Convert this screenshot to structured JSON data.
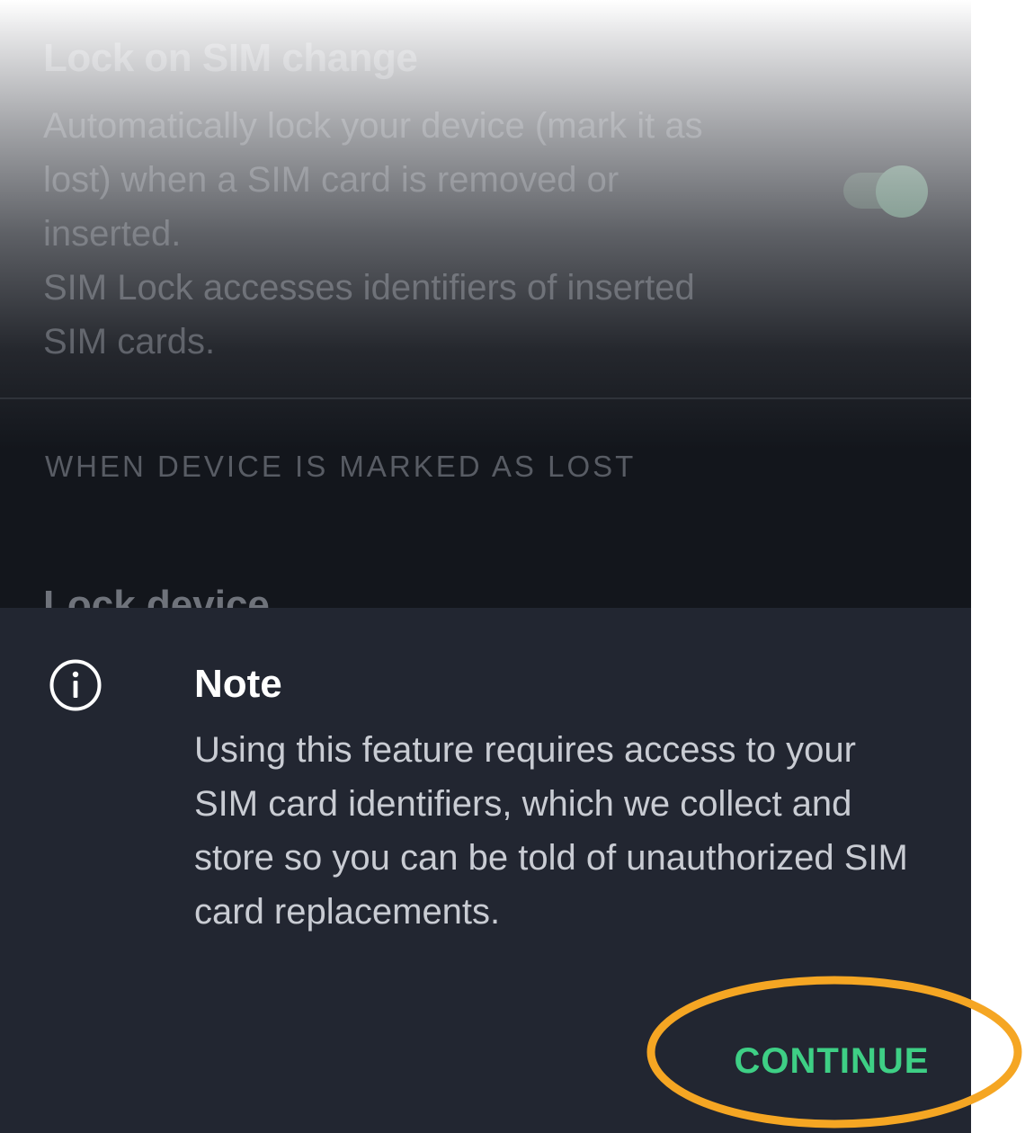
{
  "settings": {
    "lock_on_sim_change": {
      "title": "Lock on SIM change",
      "description": "Automatically lock your device (mark it as lost) when a SIM card is removed or inserted.",
      "note": "SIM Lock accesses identifiers of inserted SIM cards.",
      "enabled": true
    },
    "section_header": "WHEN DEVICE IS MARKED AS LOST",
    "lock_device": {
      "title": "Lock device"
    }
  },
  "dialog": {
    "icon": "info-icon",
    "title": "Note",
    "body": "Using this feature requires access to your SIM card identifiers, which we collect and store so you can be told of unauthorized SIM card replacements.",
    "continue_label": "CONTINUE"
  },
  "colors": {
    "accent_green": "#3ecf85",
    "highlight_orange": "#f5a623",
    "sheet_background": "#222631",
    "page_background": "#13161c"
  }
}
